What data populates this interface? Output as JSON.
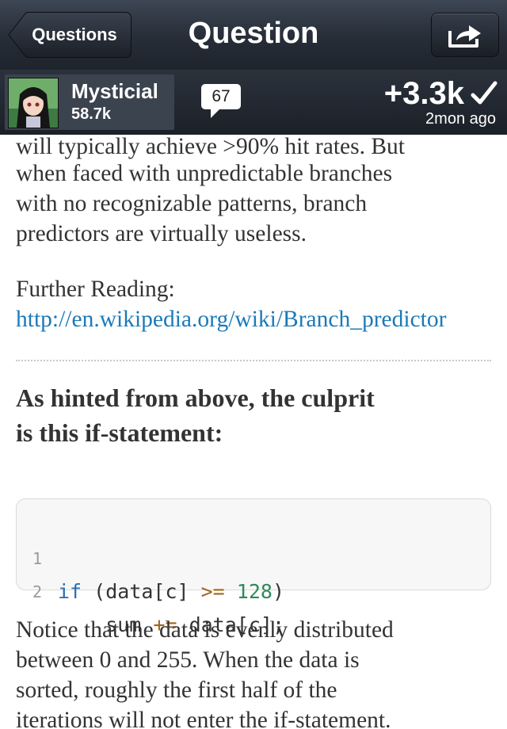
{
  "nav": {
    "back_label": "Questions",
    "title": "Question",
    "share_icon": "share-arrow-icon"
  },
  "user": {
    "name": "Mysticial",
    "reputation": "58.7k",
    "comment_count": "67",
    "score": "+3.3k",
    "accepted_icon": "checkmark-icon",
    "time_ago": "2mon ago"
  },
  "answer": {
    "para1_lines": [
      "will typically achieve >90% hit rates. But",
      "when faced with unpredictable branches",
      "with no recognizable patterns, branch",
      "predictors are virtually useless."
    ],
    "further_reading_label": "Further Reading:",
    "further_reading_link": "http://en.wikipedia.org/wiki/Branch_predictor",
    "heading_lines": [
      "As hinted from above, the culprit",
      "is this if-statement:"
    ],
    "code": [
      {
        "line_no": "1",
        "text": "if (data[c] >= 128)"
      },
      {
        "line_no": "2",
        "text": "    sum += data[c];"
      }
    ],
    "para2_lines": [
      "Notice that the data is evenly distributed",
      "between 0 and 255. When the data is",
      "sorted, roughly the first half of the",
      "iterations will not enter the if-statement."
    ]
  },
  "colors": {
    "navbar": "#262d37",
    "link": "#1a7ab8",
    "text": "#333333",
    "code_keyword": "#2a6db0"
  }
}
